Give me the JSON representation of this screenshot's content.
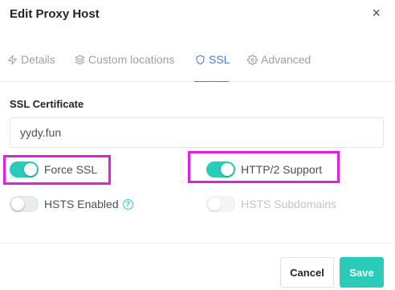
{
  "modal": {
    "title": "Edit Proxy Host",
    "close_glyph": "×"
  },
  "tabs": [
    {
      "label": "Details",
      "icon": "zap-icon",
      "active": false
    },
    {
      "label": "Custom locations",
      "icon": "layers-icon",
      "active": false
    },
    {
      "label": "SSL",
      "icon": "shield-icon",
      "active": true
    },
    {
      "label": "Advanced",
      "icon": "gear-icon",
      "active": false
    }
  ],
  "ssl": {
    "certificate_label": "SSL Certificate",
    "certificate_value": "yydy.fun",
    "force_ssl": {
      "label": "Force SSL",
      "enabled": true
    },
    "http2_support": {
      "label": "HTTP/2 Support",
      "enabled": true
    },
    "hsts_enabled": {
      "label": "HSTS Enabled",
      "enabled": false
    },
    "hsts_subdomains": {
      "label": "HSTS Subdomains",
      "enabled": false,
      "disabled": true
    },
    "help_glyph": "?"
  },
  "footer": {
    "cancel_label": "Cancel",
    "save_label": "Save"
  },
  "colors": {
    "accent": "#2bcbba",
    "tab_active": "#467fcf",
    "highlight": "#e020e0"
  }
}
